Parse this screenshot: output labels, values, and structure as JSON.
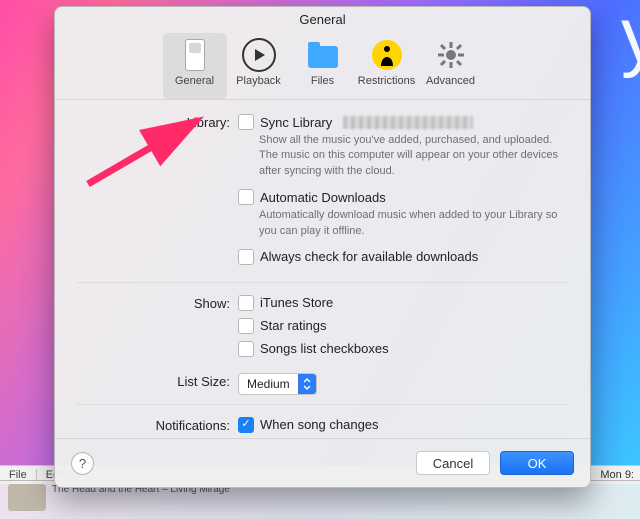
{
  "title": "General",
  "toolbar": {
    "general": "General",
    "playback": "Playback",
    "files": "Files",
    "restrictions": "Restrictions",
    "advanced": "Advanced"
  },
  "labels": {
    "library": "Library:",
    "show": "Show:",
    "listSize": "List Size:",
    "notifications": "Notifications:"
  },
  "library": {
    "sync": "Sync Library",
    "syncDesc": "Show all the music you've added, purchased, and uploaded. The music on this computer will appear on your other devices after syncing with the cloud.",
    "auto": "Automatic Downloads",
    "autoDesc": "Automatically download music when added to your Library so you can play it offline.",
    "always": "Always check for available downloads"
  },
  "show": {
    "store": "iTunes Store",
    "star": "Star ratings",
    "songsCk": "Songs list checkboxes"
  },
  "listSize": {
    "value": "Medium"
  },
  "notifications": {
    "song": "When song changes"
  },
  "footer": {
    "cancel": "Cancel",
    "ok": "OK"
  },
  "menubar": {
    "file": "File",
    "edit": "Edit",
    "clock": "Mon 9:"
  },
  "dock": {
    "track": "The Head and the Heart – Living Mirage"
  }
}
